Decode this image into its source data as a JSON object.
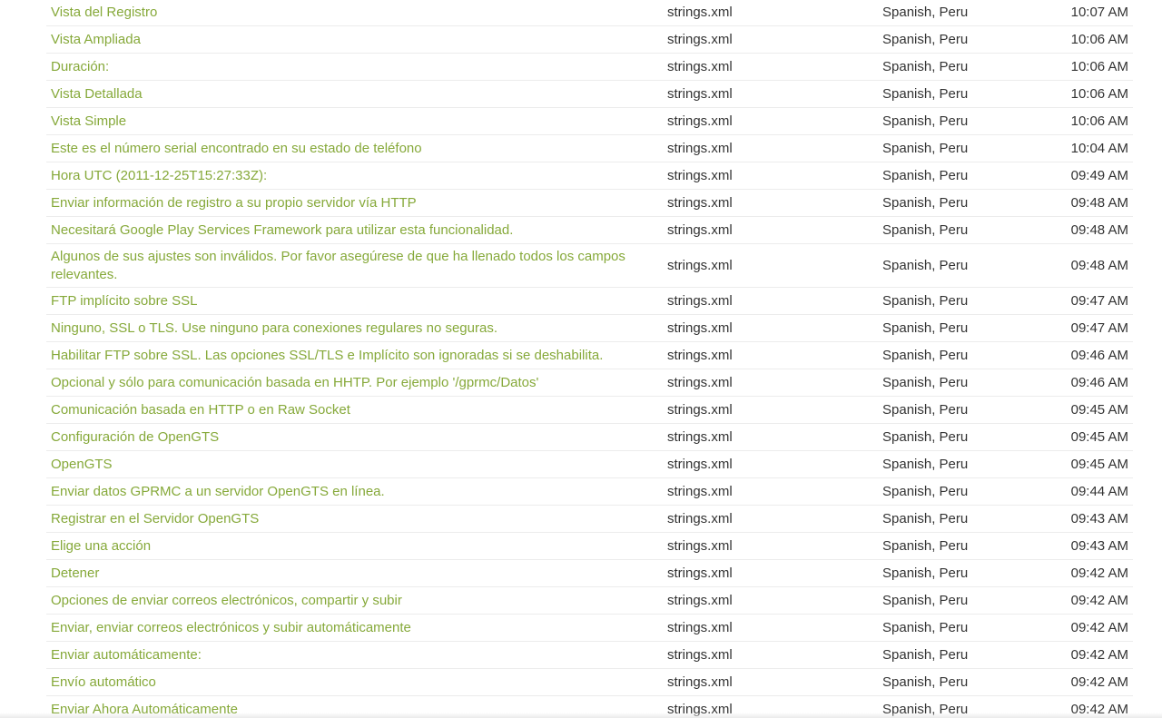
{
  "activity": {
    "rows": [
      {
        "text": "Vista del Registro",
        "file": "strings.xml",
        "language": "Spanish, Peru",
        "time": "10:07 AM"
      },
      {
        "text": "Vista Ampliada",
        "file": "strings.xml",
        "language": "Spanish, Peru",
        "time": "10:06 AM"
      },
      {
        "text": "Duración:",
        "file": "strings.xml",
        "language": "Spanish, Peru",
        "time": "10:06 AM"
      },
      {
        "text": "Vista Detallada",
        "file": "strings.xml",
        "language": "Spanish, Peru",
        "time": "10:06 AM"
      },
      {
        "text": "Vista Simple",
        "file": "strings.xml",
        "language": "Spanish, Peru",
        "time": "10:06 AM"
      },
      {
        "text": "Este es el número serial encontrado en su estado de teléfono",
        "file": "strings.xml",
        "language": "Spanish, Peru",
        "time": "10:04 AM"
      },
      {
        "text": "Hora UTC (2011-12-25T15:27:33Z):",
        "file": "strings.xml",
        "language": "Spanish, Peru",
        "time": "09:49 AM"
      },
      {
        "text": "Enviar información de registro a su propio servidor vía HTTP",
        "file": "strings.xml",
        "language": "Spanish, Peru",
        "time": "09:48 AM"
      },
      {
        "text": "Necesitará Google Play Services Framework para utilizar esta funcionalidad.",
        "file": "strings.xml",
        "language": "Spanish, Peru",
        "time": "09:48 AM"
      },
      {
        "text": "Algunos de sus ajustes son inválidos. Por favor asegúrese de que ha llenado todos los campos relevantes.",
        "file": "strings.xml",
        "language": "Spanish, Peru",
        "time": "09:48 AM"
      },
      {
        "text": "FTP implícito sobre SSL",
        "file": "strings.xml",
        "language": "Spanish, Peru",
        "time": "09:47 AM"
      },
      {
        "text": "Ninguno, SSL o TLS. Use ninguno para conexiones regulares no seguras.",
        "file": "strings.xml",
        "language": "Spanish, Peru",
        "time": "09:47 AM"
      },
      {
        "text": "Habilitar FTP sobre SSL. Las opciones SSL/TLS e Implícito son ignoradas si se deshabilita.",
        "file": "strings.xml",
        "language": "Spanish, Peru",
        "time": "09:46 AM"
      },
      {
        "text": "Opcional y sólo para comunicación basada en HHTP. Por ejemplo '/gprmc/Datos'",
        "file": "strings.xml",
        "language": "Spanish, Peru",
        "time": "09:46 AM"
      },
      {
        "text": "Comunicación basada en HTTP o en Raw Socket",
        "file": "strings.xml",
        "language": "Spanish, Peru",
        "time": "09:45 AM"
      },
      {
        "text": "Configuración de OpenGTS",
        "file": "strings.xml",
        "language": "Spanish, Peru",
        "time": "09:45 AM"
      },
      {
        "text": "OpenGTS",
        "file": "strings.xml",
        "language": "Spanish, Peru",
        "time": "09:45 AM"
      },
      {
        "text": "Enviar datos GPRMC a un servidor OpenGTS en línea.",
        "file": "strings.xml",
        "language": "Spanish, Peru",
        "time": "09:44 AM"
      },
      {
        "text": "Registrar en el Servidor OpenGTS",
        "file": "strings.xml",
        "language": "Spanish, Peru",
        "time": "09:43 AM"
      },
      {
        "text": "Elige una acción",
        "file": "strings.xml",
        "language": "Spanish, Peru",
        "time": "09:43 AM"
      },
      {
        "text": "Detener",
        "file": "strings.xml",
        "language": "Spanish, Peru",
        "time": "09:42 AM"
      },
      {
        "text": "Opciones de enviar correos electrónicos, compartir y subir",
        "file": "strings.xml",
        "language": "Spanish, Peru",
        "time": "09:42 AM"
      },
      {
        "text": "Enviar, enviar correos electrónicos y subir automáticamente",
        "file": "strings.xml",
        "language": "Spanish, Peru",
        "time": "09:42 AM"
      },
      {
        "text": "Enviar automáticamente:",
        "file": "strings.xml",
        "language": "Spanish, Peru",
        "time": "09:42 AM"
      },
      {
        "text": "Envío automático",
        "file": "strings.xml",
        "language": "Spanish, Peru",
        "time": "09:42 AM"
      },
      {
        "text": "Enviar Ahora Automáticamente",
        "file": "strings.xml",
        "language": "Spanish, Peru",
        "time": "09:42 AM"
      }
    ]
  },
  "colors": {
    "link": "#86a93a",
    "text": "#333333",
    "row_border": "#ececec"
  }
}
